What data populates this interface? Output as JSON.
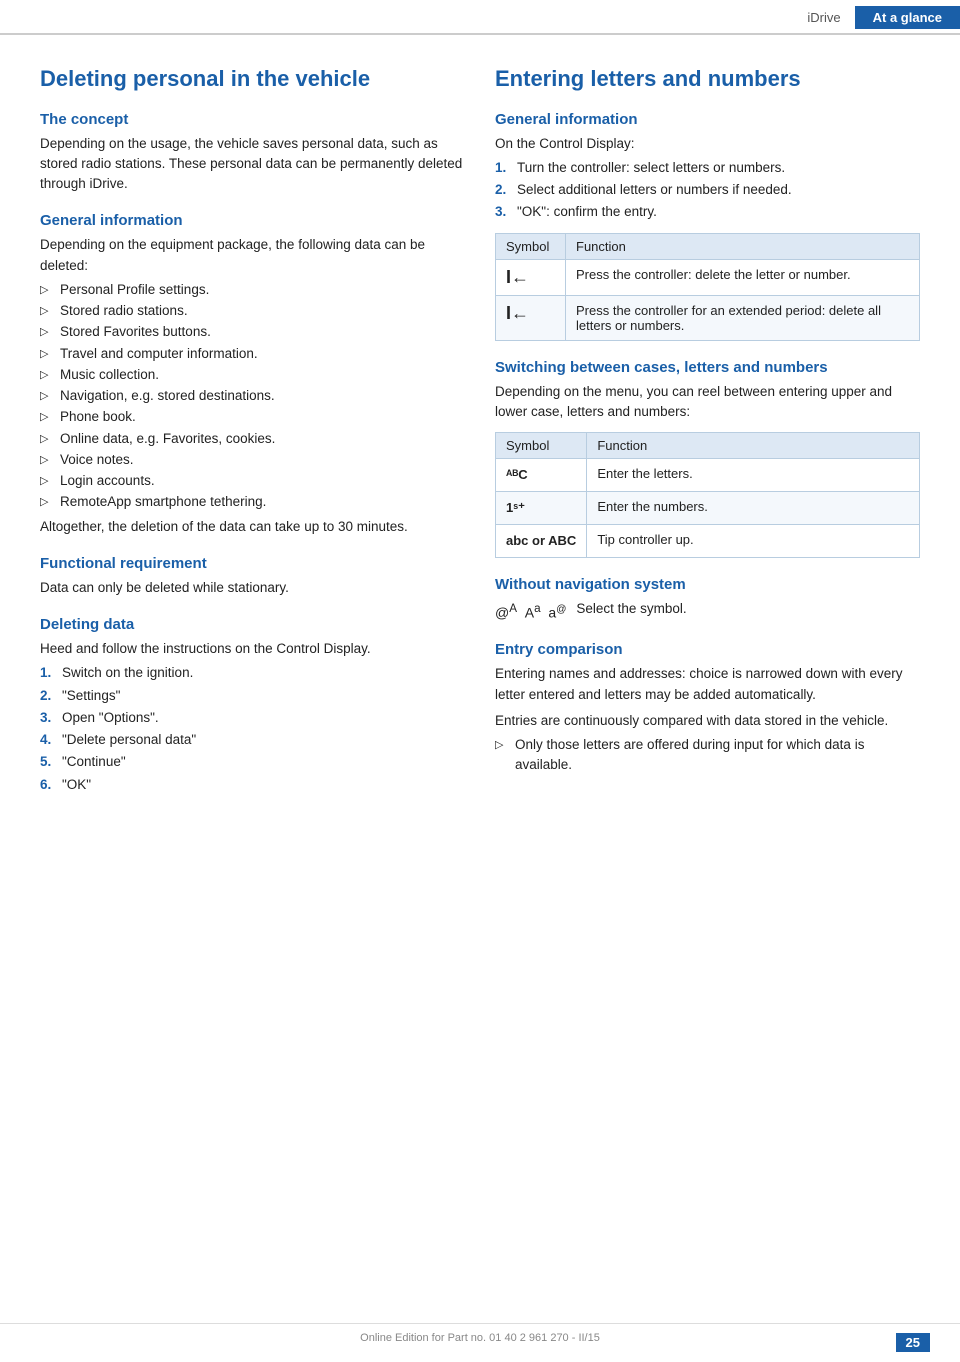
{
  "header": {
    "idrive_label": "iDrive",
    "ataglance_label": "At a glance"
  },
  "left": {
    "page_title": "Deleting personal in the vehicle",
    "concept_heading": "The concept",
    "concept_body": "Depending on the usage, the vehicle saves personal data, such as stored radio stations. These personal data can be permanently deleted through iDrive.",
    "general_info_heading": "General information",
    "general_info_body": "Depending on the equipment package, the following data can be deleted:",
    "bullet_items": [
      "Personal Profile settings.",
      "Stored radio stations.",
      "Stored Favorites buttons.",
      "Travel and computer information.",
      "Music collection.",
      "Navigation, e.g. stored destinations.",
      "Phone book.",
      "Online data, e.g. Favorites, cookies.",
      "Voice notes.",
      "Login accounts.",
      "RemoteApp smartphone tethering."
    ],
    "general_info_footer": "Altogether, the deletion of the data can take up to 30 minutes.",
    "functional_req_heading": "Functional requirement",
    "functional_req_body": "Data can only be deleted while stationary.",
    "deleting_data_heading": "Deleting data",
    "deleting_data_body": "Heed and follow the instructions on the Control Display.",
    "steps": [
      {
        "num": "1.",
        "text": "Switch on the ignition."
      },
      {
        "num": "2.",
        "text": "\"Settings\""
      },
      {
        "num": "3.",
        "text": "Open \"Options\"."
      },
      {
        "num": "4.",
        "text": "\"Delete personal data\""
      },
      {
        "num": "5.",
        "text": "\"Continue\""
      },
      {
        "num": "6.",
        "text": "\"OK\""
      }
    ]
  },
  "right": {
    "page_title": "Entering letters and numbers",
    "general_info_heading": "General information",
    "general_info_intro": "On the Control Display:",
    "steps": [
      {
        "num": "1.",
        "text": "Turn the controller: select letters or numbers."
      },
      {
        "num": "2.",
        "text": "Select additional letters or numbers if needed."
      },
      {
        "num": "3.",
        "text": "\"OK\": confirm the entry."
      }
    ],
    "table1": {
      "headers": [
        "Symbol",
        "Function"
      ],
      "rows": [
        {
          "symbol": "I←",
          "function": "Press the controller: delete the letter or number."
        },
        {
          "symbol": "I←",
          "function": "Press the controller for an extended period: delete all letters or numbers."
        }
      ]
    },
    "switching_heading": "Switching between cases, letters and numbers",
    "switching_body": "Depending on the menu, you can reel between entering upper and lower case, letters and numbers:",
    "table2": {
      "headers": [
        "Symbol",
        "Function"
      ],
      "rows": [
        {
          "symbol": "ᴬᴮC",
          "function": "Enter the letters."
        },
        {
          "symbol": "1ˢ⁺",
          "function": "Enter the numbers."
        },
        {
          "symbol": "abc or ABC",
          "function": "Tip controller up."
        }
      ]
    },
    "without_nav_heading": "Without navigation system",
    "without_nav_body": "Select the symbol.",
    "without_nav_symbols": "@ᴬ  Aᵃ  aᵖ",
    "entry_comparison_heading": "Entry comparison",
    "entry_comparison_body1": "Entering names and addresses: choice is narrowed down with every letter entered and letters may be added automatically.",
    "entry_comparison_body2": "Entries are continuously compared with data stored in the vehicle.",
    "entry_bullet": "Only those letters are offered during input for which data is available."
  },
  "footer": {
    "text": "Online Edition for Part no. 01 40 2 961 270 - II/15",
    "page_number": "25"
  }
}
